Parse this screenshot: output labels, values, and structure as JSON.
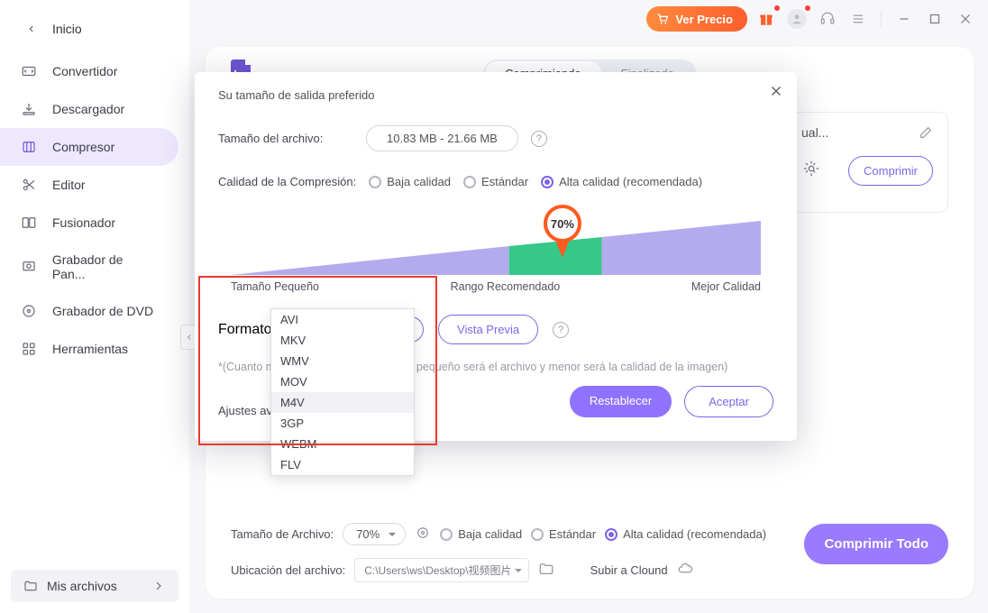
{
  "titlebar": {
    "ver_precio": "Ver Precio"
  },
  "sidebar": {
    "home": "Inicio",
    "items": [
      "Convertidor",
      "Descargador",
      "Compresor",
      "Editor",
      "Fusionador",
      "Grabador de Pan...",
      "Grabador de DVD",
      "Herramientas"
    ],
    "mis_archivos": "Mis archivos"
  },
  "main": {
    "tabs": {
      "compressing": "Comprimiendo",
      "finished": "Finalizado"
    },
    "side_card": {
      "title": "ual...",
      "button": "Comprimir"
    },
    "bottom": {
      "size_label": "Tamaño de Archivo:",
      "size_value": "70%",
      "q_low": "Baja calidad",
      "q_std": "Estándar",
      "q_high": "Alta calidad (recomendada)",
      "loc_label": "Ubicación del archivo:",
      "loc_value": "C:\\Users\\ws\\Desktop\\视频图片",
      "cloud": "Subir a Clound",
      "big_button": "Comprimir Todo"
    }
  },
  "modal": {
    "title": "Su tamaño de salida preferido",
    "file_size_label": "Tamaño del archivo:",
    "file_size_value": "10.83 MB - 21.66 MB",
    "quality_label": "Calidad de la Compresión:",
    "q_low": "Baja calidad",
    "q_std": "Estándar",
    "q_high": "Alta calidad (recomendada)",
    "handle_pct": "70%",
    "legend_small": "Tamaño Pequeño",
    "legend_rec": "Rango Recomendado",
    "legend_best": "Mejor Calidad",
    "format_label": "Formato:",
    "format_value": "M4V",
    "preview": "Vista Previa",
    "hint_prefix": "*(Cuanto m",
    "hint_suffix": "ás pequeño será el archivo y menor será la calidad de la imagen)",
    "advanced": "Ajustes av",
    "reset": "Restablecer",
    "accept": "Aceptar",
    "options": [
      "AVI",
      "MKV",
      "WMV",
      "MOV",
      "M4V",
      "3GP",
      "WEBM",
      "FLV"
    ]
  }
}
